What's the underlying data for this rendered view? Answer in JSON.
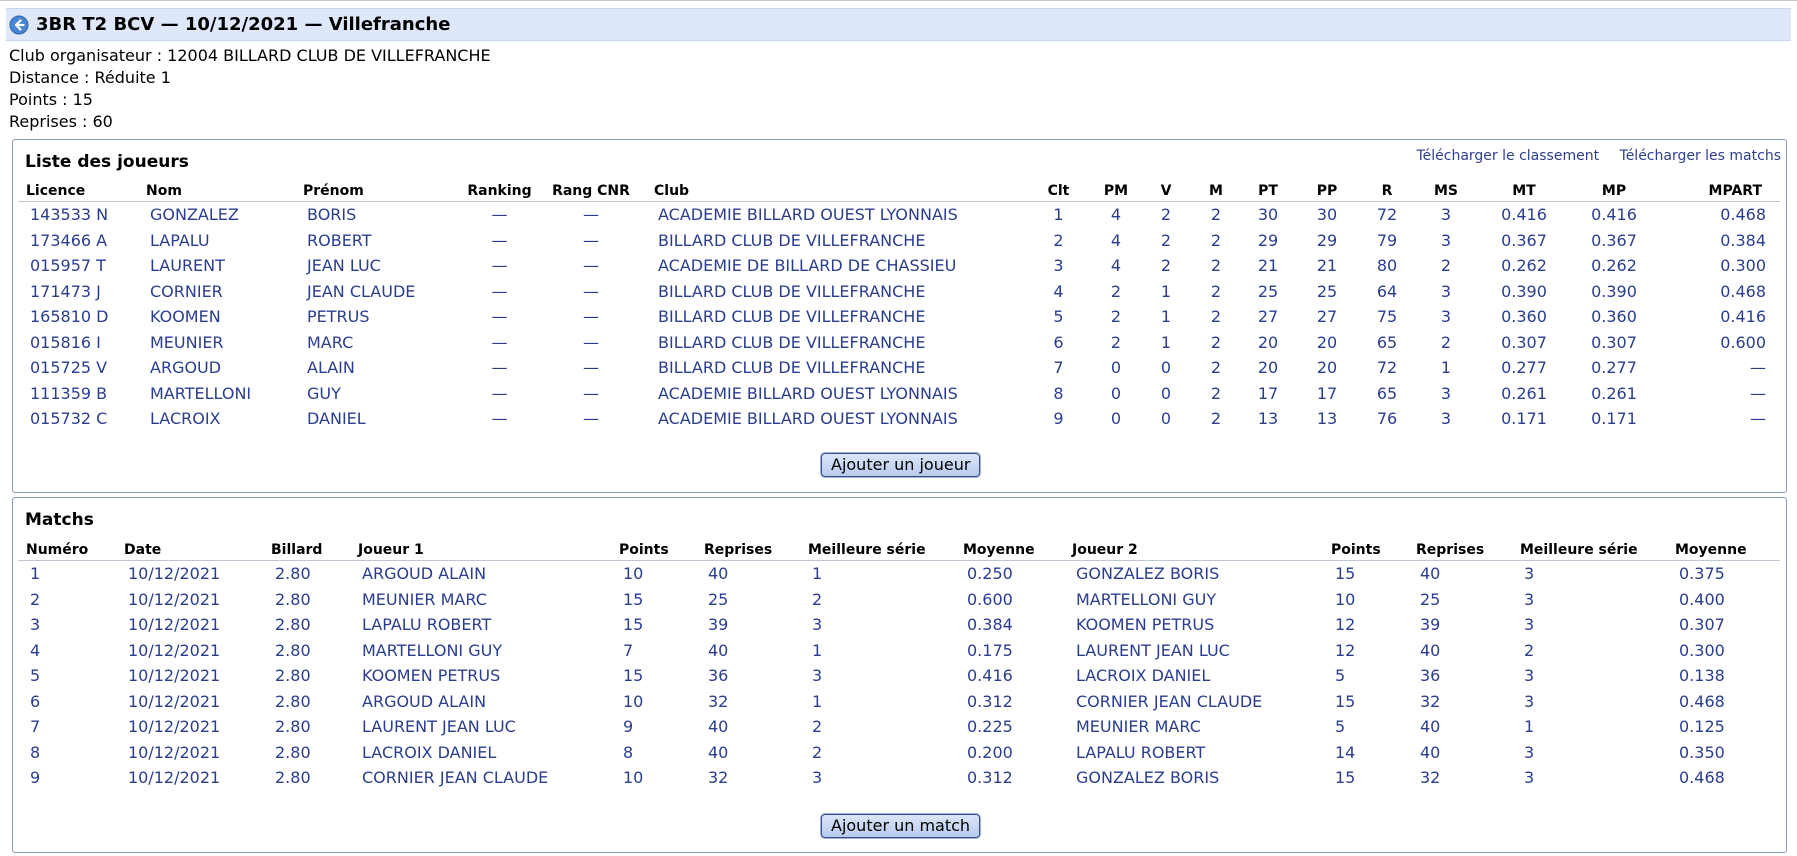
{
  "header": {
    "title": "3BR T2 BCV — 10/12/2021 — Villefranche"
  },
  "infos": {
    "club": "Club organisateur : 12004 BILLARD CLUB DE VILLEFRANCHE",
    "distance": "Distance : Réduite 1",
    "points": "Points : 15",
    "reprises": "Reprises : 60"
  },
  "joueurs": {
    "title": "Liste des joueurs",
    "link_classement": "Télécharger le classement",
    "link_matchs": "Télécharger les matchs",
    "columns": [
      "Licence",
      "Nom",
      "Prénom",
      "Ranking",
      "Rang CNR",
      "Club",
      "Clt",
      "PM",
      "V",
      "M",
      "PT",
      "PP",
      "R",
      "MS",
      "MT",
      "MP",
      "MPART"
    ],
    "rows": [
      [
        "143533 N",
        "GONZALEZ",
        "BORIS",
        "—",
        "—",
        "ACADEMIE BILLARD OUEST LYONNAIS",
        "1",
        "4",
        "2",
        "2",
        "30",
        "30",
        "72",
        "3",
        "0.416",
        "0.416",
        "0.468"
      ],
      [
        "173466 A",
        "LAPALU",
        "ROBERT",
        "—",
        "—",
        "BILLARD CLUB DE VILLEFRANCHE",
        "2",
        "4",
        "2",
        "2",
        "29",
        "29",
        "79",
        "3",
        "0.367",
        "0.367",
        "0.384"
      ],
      [
        "015957 T",
        "LAURENT",
        "JEAN LUC",
        "—",
        "—",
        "ACADEMIE DE BILLARD DE CHASSIEU",
        "3",
        "4",
        "2",
        "2",
        "21",
        "21",
        "80",
        "2",
        "0.262",
        "0.262",
        "0.300"
      ],
      [
        "171473 J",
        "CORNIER",
        "JEAN CLAUDE",
        "—",
        "—",
        "BILLARD CLUB DE VILLEFRANCHE",
        "4",
        "2",
        "1",
        "2",
        "25",
        "25",
        "64",
        "3",
        "0.390",
        "0.390",
        "0.468"
      ],
      [
        "165810 D",
        "KOOMEN",
        "PETRUS",
        "—",
        "—",
        "BILLARD CLUB DE VILLEFRANCHE",
        "5",
        "2",
        "1",
        "2",
        "27",
        "27",
        "75",
        "3",
        "0.360",
        "0.360",
        "0.416"
      ],
      [
        "015816 I",
        "MEUNIER",
        "MARC",
        "—",
        "—",
        "BILLARD CLUB DE VILLEFRANCHE",
        "6",
        "2",
        "1",
        "2",
        "20",
        "20",
        "65",
        "2",
        "0.307",
        "0.307",
        "0.600"
      ],
      [
        "015725 V",
        "ARGOUD",
        "ALAIN",
        "—",
        "—",
        "BILLARD CLUB DE VILLEFRANCHE",
        "7",
        "0",
        "0",
        "2",
        "20",
        "20",
        "72",
        "1",
        "0.277",
        "0.277",
        "—"
      ],
      [
        "111359 B",
        "MARTELLONI",
        "GUY",
        "—",
        "—",
        "ACADEMIE BILLARD OUEST LYONNAIS",
        "8",
        "0",
        "0",
        "2",
        "17",
        "17",
        "65",
        "3",
        "0.261",
        "0.261",
        "—"
      ],
      [
        "015732 C",
        "LACROIX",
        "DANIEL",
        "—",
        "—",
        "ACADEMIE BILLARD OUEST LYONNAIS",
        "9",
        "0",
        "0",
        "2",
        "13",
        "13",
        "76",
        "3",
        "0.171",
        "0.171",
        "—"
      ]
    ],
    "add_button": "Ajouter un joueur"
  },
  "matchs": {
    "title": "Matchs",
    "columns": [
      "Numéro",
      "Date",
      "Billard",
      "Joueur 1",
      "Points",
      "Reprises",
      "Meilleure série",
      "Moyenne",
      "Joueur 2",
      "Points",
      "Reprises",
      "Meilleure série",
      "Moyenne"
    ],
    "rows": [
      [
        "1",
        "10/12/2021",
        "2.80",
        "ARGOUD ALAIN",
        "10",
        "40",
        "1",
        "0.250",
        "GONZALEZ BORIS",
        "15",
        "40",
        "3",
        "0.375"
      ],
      [
        "2",
        "10/12/2021",
        "2.80",
        "MEUNIER MARC",
        "15",
        "25",
        "2",
        "0.600",
        "MARTELLONI GUY",
        "10",
        "25",
        "3",
        "0.400"
      ],
      [
        "3",
        "10/12/2021",
        "2.80",
        "LAPALU ROBERT",
        "15",
        "39",
        "3",
        "0.384",
        "KOOMEN PETRUS",
        "12",
        "39",
        "3",
        "0.307"
      ],
      [
        "4",
        "10/12/2021",
        "2.80",
        "MARTELLONI GUY",
        "7",
        "40",
        "1",
        "0.175",
        "LAURENT JEAN LUC",
        "12",
        "40",
        "2",
        "0.300"
      ],
      [
        "5",
        "10/12/2021",
        "2.80",
        "KOOMEN PETRUS",
        "15",
        "36",
        "3",
        "0.416",
        "LACROIX DANIEL",
        "5",
        "36",
        "3",
        "0.138"
      ],
      [
        "6",
        "10/12/2021",
        "2.80",
        "ARGOUD ALAIN",
        "10",
        "32",
        "1",
        "0.312",
        "CORNIER JEAN CLAUDE",
        "15",
        "32",
        "3",
        "0.468"
      ],
      [
        "7",
        "10/12/2021",
        "2.80",
        "LAURENT JEAN LUC",
        "9",
        "40",
        "2",
        "0.225",
        "MEUNIER MARC",
        "5",
        "40",
        "1",
        "0.125"
      ],
      [
        "8",
        "10/12/2021",
        "2.80",
        "LACROIX DANIEL",
        "8",
        "40",
        "2",
        "0.200",
        "LAPALU ROBERT",
        "14",
        "40",
        "3",
        "0.350"
      ],
      [
        "9",
        "10/12/2021",
        "2.80",
        "CORNIER JEAN CLAUDE",
        "10",
        "32",
        "3",
        "0.312",
        "GONZALEZ BORIS",
        "15",
        "32",
        "3",
        "0.468"
      ]
    ],
    "add_button": "Ajouter un match"
  },
  "colors": {
    "header_bg": "#dfe8fb",
    "link_text": "#2a3d8f",
    "back_icon": "#4a86d6"
  },
  "icons": {
    "back": "back-arrow-circle-icon"
  }
}
